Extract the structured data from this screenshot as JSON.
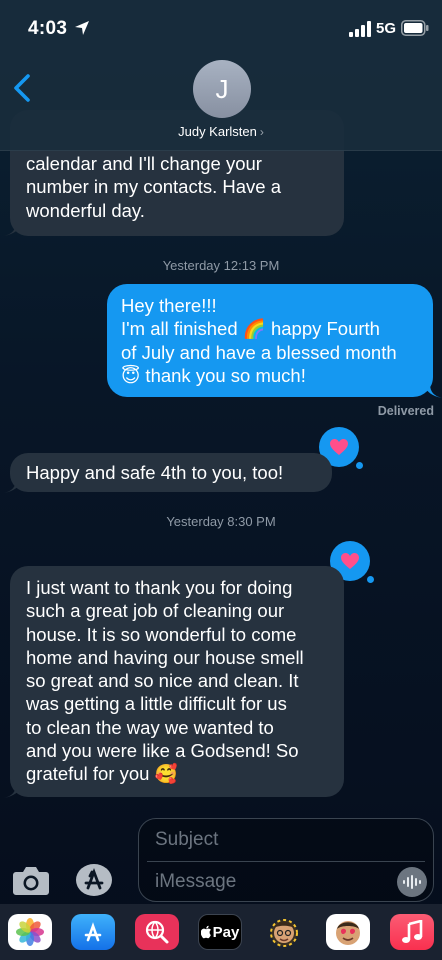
{
  "status_bar": {
    "time": "4:03",
    "network": "5G",
    "location_icon": "location-arrow-icon",
    "signal_icon": "cellular-signal-icon",
    "battery_icon": "battery-icon"
  },
  "header": {
    "back_icon": "chevron-left-icon",
    "avatar_initial": "J",
    "contact_name": "Judy Karlsten",
    "contact_chevron": "›"
  },
  "messages": {
    "received_1": "calendar and I'll change your\nnumber in my contacts. Have a\nwonderful day.",
    "timestamp_1": "Yesterday 12:13 PM",
    "sent_1": "Hey there!!!\nI'm all finished 🌈 happy Fourth\nof July and have a blessed month\n😇 thank you so much!",
    "delivered": "Delivered",
    "received_2": "Happy and safe 4th to you, too!",
    "timestamp_2": "Yesterday 8:30 PM",
    "received_3": "I just want to thank you for doing\nsuch a great job of cleaning our\nhouse. It is so wonderful to come\nhome and having our house smell\nso great and so nice and clean. It\nwas getting a little difficult for us\nto clean the way we wanted to\nand you were like a Godsend!  So\ngrateful for you 🥰",
    "tapback_icon": "heart-icon"
  },
  "composer": {
    "subject_placeholder": "Subject",
    "message_placeholder": "iMessage",
    "camera_icon": "camera-icon",
    "appstore_icon": "app-store-icon",
    "audio_icon": "waveform-icon"
  },
  "app_drawer": {
    "apple_pay_label": "Pay",
    "apple_pay_logo": "",
    "apps": [
      "photos-app",
      "app-store-app",
      "web-images-app",
      "apple-pay-app",
      "memoji-app",
      "animoji-app",
      "music-app"
    ]
  },
  "colors": {
    "background": "#081627",
    "incoming_bubble": "#26323f",
    "outgoing_bubble": "#1598f1",
    "timestamp_text": "#8f9aa6",
    "accent": "#1598f1",
    "heart": "#ff4f8b"
  }
}
